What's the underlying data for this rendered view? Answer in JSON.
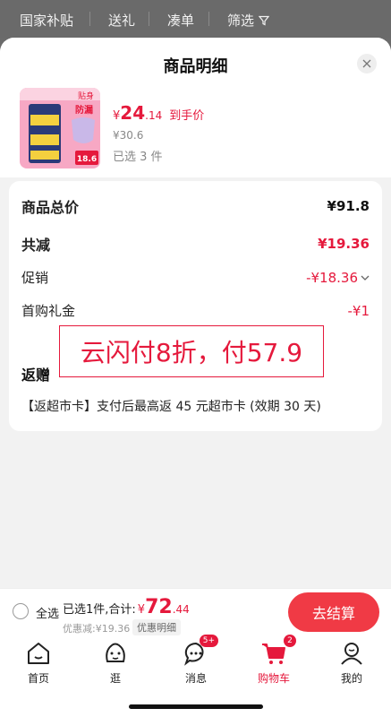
{
  "filterbar": {
    "items": [
      "国家补贴",
      "送礼",
      "凑单",
      "筛选"
    ]
  },
  "sheet": {
    "title": "商品明细"
  },
  "product": {
    "thumb_badges": [
      "贴身",
      "防漏"
    ],
    "thumb_price": "18.6",
    "price_currency": "¥",
    "price_int": "24",
    "price_dec": ".14",
    "price_tag": "到手价",
    "original_price": "¥30.6",
    "selected": "已选 3 件"
  },
  "breakdown": {
    "total_label": "商品总价",
    "total_value": "¥91.8",
    "discount_label": "共减",
    "discount_value": "¥19.36",
    "promo_label": "促销",
    "promo_value": "-¥18.36",
    "coupon_label": "首购礼金",
    "coupon_value": "-¥1"
  },
  "overlay": {
    "text": "云闪付8折，付57.9"
  },
  "gift": {
    "title": "返赠",
    "text": "【返超市卡】支付后最高返 45 元超市卡 (效期 30 天)"
  },
  "checkout": {
    "select_all": "全选",
    "summary_prefix": "已选1件,合计:",
    "total_currency": "¥",
    "total_int": "72",
    "total_dec": ".44",
    "saved": "优惠减:¥19.36",
    "detail_link": "优惠明细",
    "pay_button": "去结算"
  },
  "tabs": [
    {
      "label": "首页",
      "icon": "home-icon"
    },
    {
      "label": "逛",
      "icon": "face-icon"
    },
    {
      "label": "消息",
      "icon": "message-icon",
      "badge": "5+"
    },
    {
      "label": "购物车",
      "icon": "cart-icon",
      "badge": "2",
      "active": true
    },
    {
      "label": "我的",
      "icon": "user-icon"
    }
  ],
  "colors": {
    "accent": "#e5193c",
    "button": "#f03a45"
  }
}
